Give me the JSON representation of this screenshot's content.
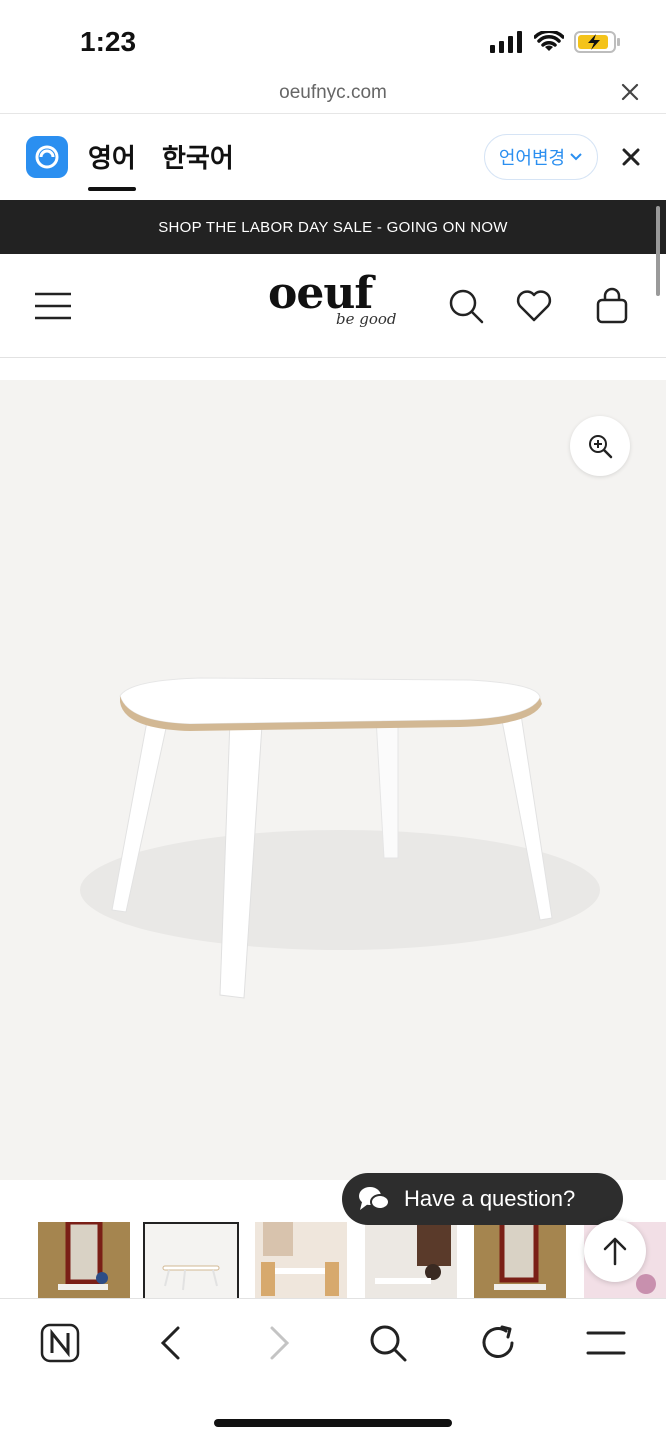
{
  "status_bar": {
    "time": "1:23"
  },
  "url_bar": {
    "url": "oeufnyc.com"
  },
  "translate_bar": {
    "tabs": [
      {
        "label": "영어",
        "active": true
      },
      {
        "label": "한국어",
        "active": false
      }
    ],
    "change_language_label": "언어변경",
    "accent_color": "#2b8ff0"
  },
  "promo": {
    "text": "SHOP THE LABOR DAY SALE - GOING ON NOW"
  },
  "site_header": {
    "brand": "oeuf",
    "tagline": "be good"
  },
  "product": {
    "thumbnails": [
      {
        "name": "thumb-room-child"
      },
      {
        "name": "thumb-white-table",
        "selected": true
      },
      {
        "name": "thumb-table-chairs"
      },
      {
        "name": "thumb-child-room"
      },
      {
        "name": "thumb-room-window"
      },
      {
        "name": "thumb-pink-set"
      }
    ]
  },
  "chat": {
    "label": "Have a question?"
  },
  "toolbar": {
    "buttons": [
      "naver-home-icon",
      "back-icon",
      "forward-icon",
      "search-icon",
      "reload-icon",
      "menu-icon"
    ]
  }
}
